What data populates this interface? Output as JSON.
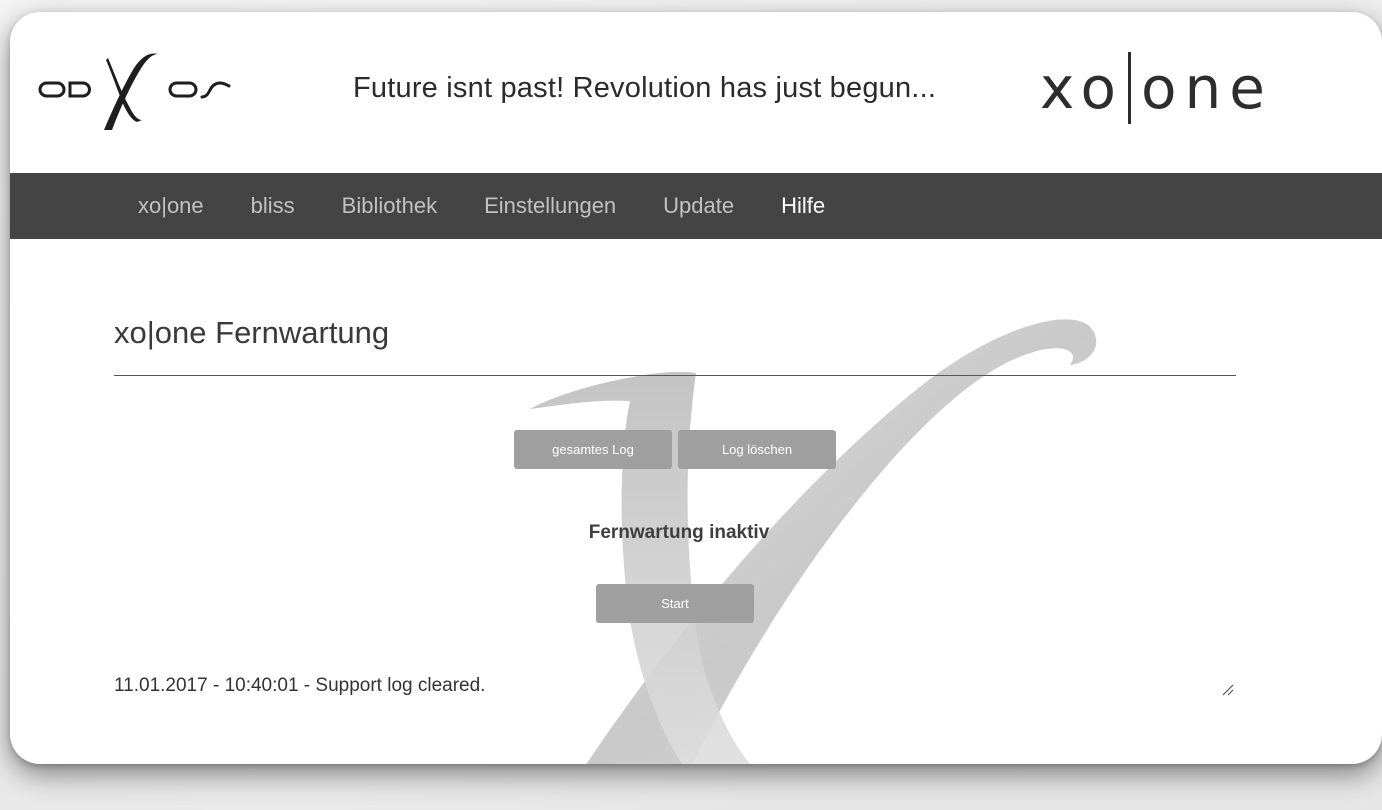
{
  "header": {
    "logo_text": "odXos",
    "slogan": "Future isnt past! Revolution has just begun...",
    "brand_left": "xo",
    "brand_right": "one"
  },
  "nav": {
    "items": [
      {
        "label": "xo|one",
        "active": false
      },
      {
        "label": "bliss",
        "active": false
      },
      {
        "label": "Bibliothek",
        "active": false
      },
      {
        "label": "Einstellungen",
        "active": false
      },
      {
        "label": "Update",
        "active": false
      },
      {
        "label": "Hilfe",
        "active": true
      }
    ]
  },
  "main": {
    "page_title": "xo|one Fernwartung",
    "buttons": {
      "full_log": "gesamtes Log",
      "clear_log": "Log löschen",
      "start": "Start"
    },
    "status": "Fernwartung inaktiv",
    "log_text": "11.01.2017 - 10:40:01 - Support log cleared."
  },
  "colors": {
    "nav_background": "#444444",
    "nav_text": "#c2c2c2",
    "nav_active_text": "#ffffff",
    "button_background": "#9f9f9f",
    "button_text": "#ffffff"
  }
}
